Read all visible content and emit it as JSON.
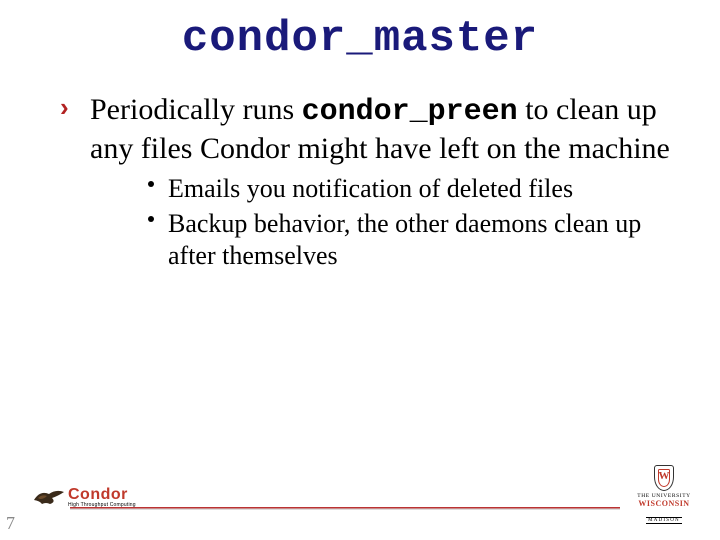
{
  "title": "condor_master",
  "bullets": [
    {
      "pre": "Periodically runs ",
      "code": "condor_preen",
      "post": " to clean up any files Condor might have left on the machine",
      "sub": [
        "Emails you notification of deleted files",
        "Backup behavior, the other daemons clean up after themselves"
      ]
    }
  ],
  "footer": {
    "page": "7",
    "condor_word": "Condor",
    "condor_sub": "High Throughput Computing",
    "wisc_u": "THE UNIVERSITY",
    "wisc_w": "WISCONSIN",
    "wisc_m": "MADISON"
  }
}
